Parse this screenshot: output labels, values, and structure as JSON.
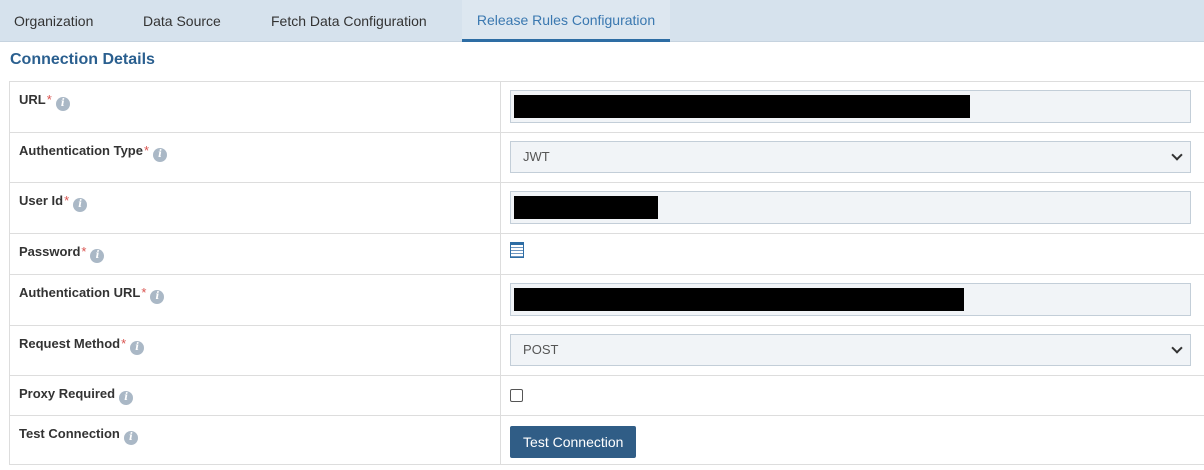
{
  "tabs": [
    {
      "label": "Organization"
    },
    {
      "label": "Data Source"
    },
    {
      "label": "Fetch Data Configuration"
    },
    {
      "label": "Release Rules Configuration"
    }
  ],
  "section_title": "Connection Details",
  "required_mark": "*",
  "info_glyph": "i",
  "fields": {
    "url": {
      "label": "URL"
    },
    "auth_type": {
      "label": "Authentication Type",
      "value": "JWT"
    },
    "user_id": {
      "label": "User Id"
    },
    "password": {
      "label": "Password"
    },
    "auth_url": {
      "label": "Authentication URL"
    },
    "request_method": {
      "label": "Request Method",
      "value": "POST"
    },
    "proxy_required": {
      "label": "Proxy Required",
      "checked": false
    },
    "test_connection": {
      "label": "Test Connection",
      "button_label": "Test Connection"
    }
  },
  "colors": {
    "accent": "#2e6da4",
    "button": "#305d86",
    "required": "#d9534f",
    "tabbar": "#d6e2ed"
  }
}
